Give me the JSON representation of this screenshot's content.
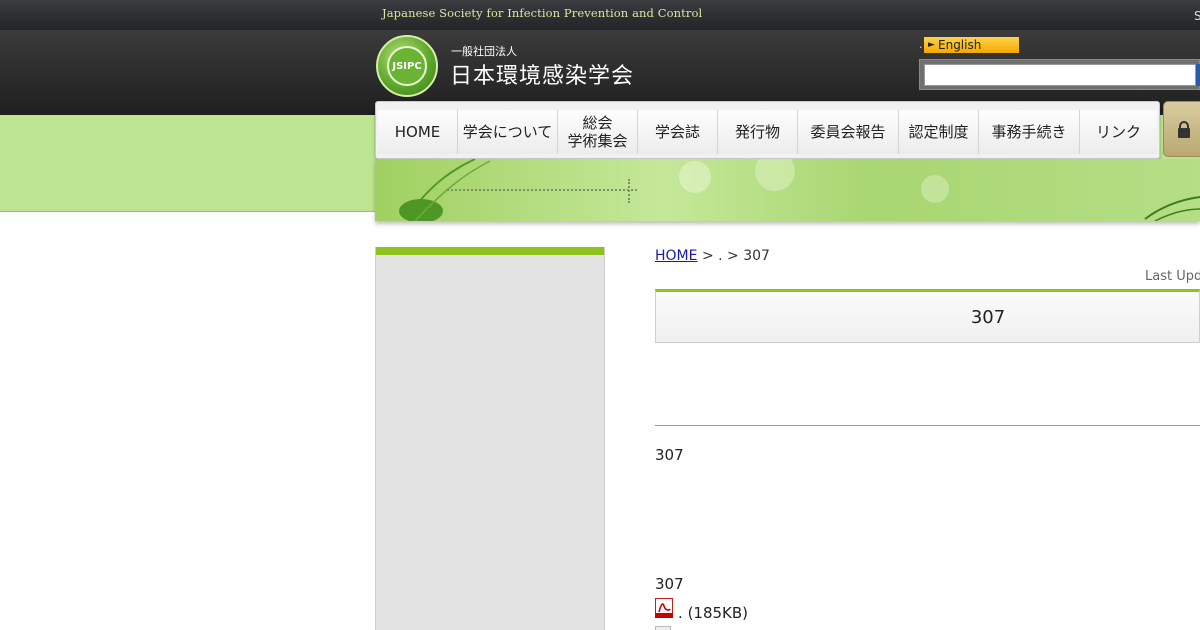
{
  "topbar": {
    "tagline": "Japanese Society for Infection Prevention and Control",
    "right_text": "S"
  },
  "header": {
    "logo_text": "JSIPC",
    "org_type": "一般社団法人",
    "org_name": "日本環境感染学会",
    "lang_dot": ".",
    "english_label": "English",
    "search_placeholder": ""
  },
  "nav": {
    "items": [
      {
        "label": "HOME"
      },
      {
        "label": "学会について"
      },
      {
        "label_line1": "総会",
        "label_line2": "学術集会"
      },
      {
        "label": "学会誌"
      },
      {
        "label": "発行物"
      },
      {
        "label": "委員会報告"
      },
      {
        "label": "認定制度"
      },
      {
        "label": "事務手続き"
      },
      {
        "label": "リンク"
      }
    ],
    "members_icon": "lock-icon"
  },
  "breadcrumb": {
    "home": "HOME",
    "sep1": ">",
    "middle": ".",
    "sep2": ">",
    "current": "307"
  },
  "main": {
    "last_updated": "Last Upd",
    "title": "307",
    "issue_heading": "307",
    "issue_heading_2": "307",
    "pdf_label": ".",
    "pdf_size": "(185KB)"
  },
  "colors": {
    "accent_green": "#8dc21f",
    "band_green": "#bde591",
    "english_yellow": "#ffc21f"
  }
}
